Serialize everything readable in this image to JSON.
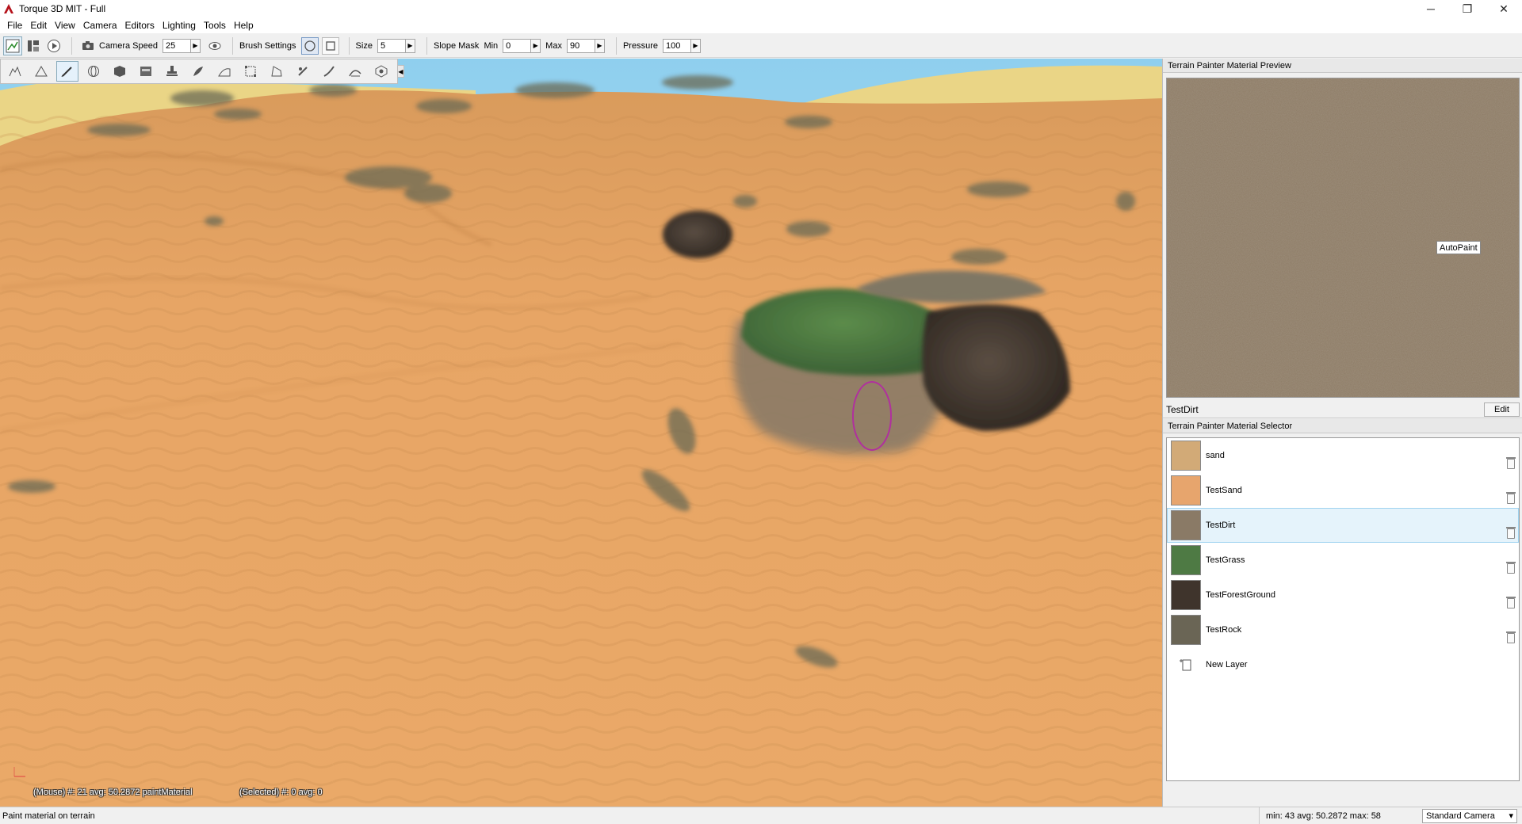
{
  "window": {
    "title": "Torque 3D MIT - Full",
    "min_glyph": "─",
    "restore_glyph": "❐",
    "close_glyph": "✕"
  },
  "menu": [
    "File",
    "Edit",
    "View",
    "Camera",
    "Editors",
    "Lighting",
    "Tools",
    "Help"
  ],
  "toolbar": {
    "camera_speed_label": "Camera Speed",
    "camera_speed_value": "25",
    "brush_settings_label": "Brush Settings",
    "size_label": "Size",
    "size_value": "5",
    "slope_mask_label": "Slope Mask",
    "min_label": "Min",
    "min_value": "0",
    "max_label": "Max",
    "max_value": "90",
    "pressure_label": "Pressure",
    "pressure_value": "100"
  },
  "tool_palette": {
    "icons": [
      "raise-height-icon",
      "lower-height-icon",
      "paint-material-icon",
      "sphere-tool-icon",
      "cube-tool-icon",
      "flatten-icon",
      "stamp-icon",
      "smooth-icon",
      "slope-icon",
      "select-icon",
      "noise-icon",
      "pinch-icon",
      "brush-tool-icon",
      "erode-icon",
      "view-icon"
    ],
    "active_index": 2
  },
  "viewport": {
    "mouse_readout": "(Mouse) #: 21  avg: 50.2872 paintMaterial",
    "selected_readout": "(Selected) #: 0  avg: 0"
  },
  "preview_panel": {
    "title": "Terrain Painter Material Preview",
    "autopaint_label": "AutoPaint",
    "material_name": "TestDirt",
    "edit_label": "Edit"
  },
  "selector_panel": {
    "title": "Terrain Painter Material Selector",
    "materials": [
      {
        "name": "sand",
        "color": "#d2aa77"
      },
      {
        "name": "TestSand",
        "color": "#e7a56d"
      },
      {
        "name": "TestDirt",
        "color": "#8a7a66"
      },
      {
        "name": "TestGrass",
        "color": "#4e7a44"
      },
      {
        "name": "TestForestGround",
        "color": "#3f342c"
      },
      {
        "name": "TestRock",
        "color": "#6a6555"
      }
    ],
    "selected_index": 2,
    "new_layer_label": "New Layer"
  },
  "statusbar": {
    "message": "Paint material on terrain",
    "stats": "min: 43  avg: 50.2872  max: 58",
    "camera_mode": "Standard Camera"
  },
  "colors": {
    "sky_top": "#a9d8f2",
    "sand": "#e7a565",
    "sand_dark": "#c98a4e",
    "hill_yellow": "#ead586",
    "brush_ring": "#b0309e",
    "selection_blue": "#e5f3fb"
  }
}
